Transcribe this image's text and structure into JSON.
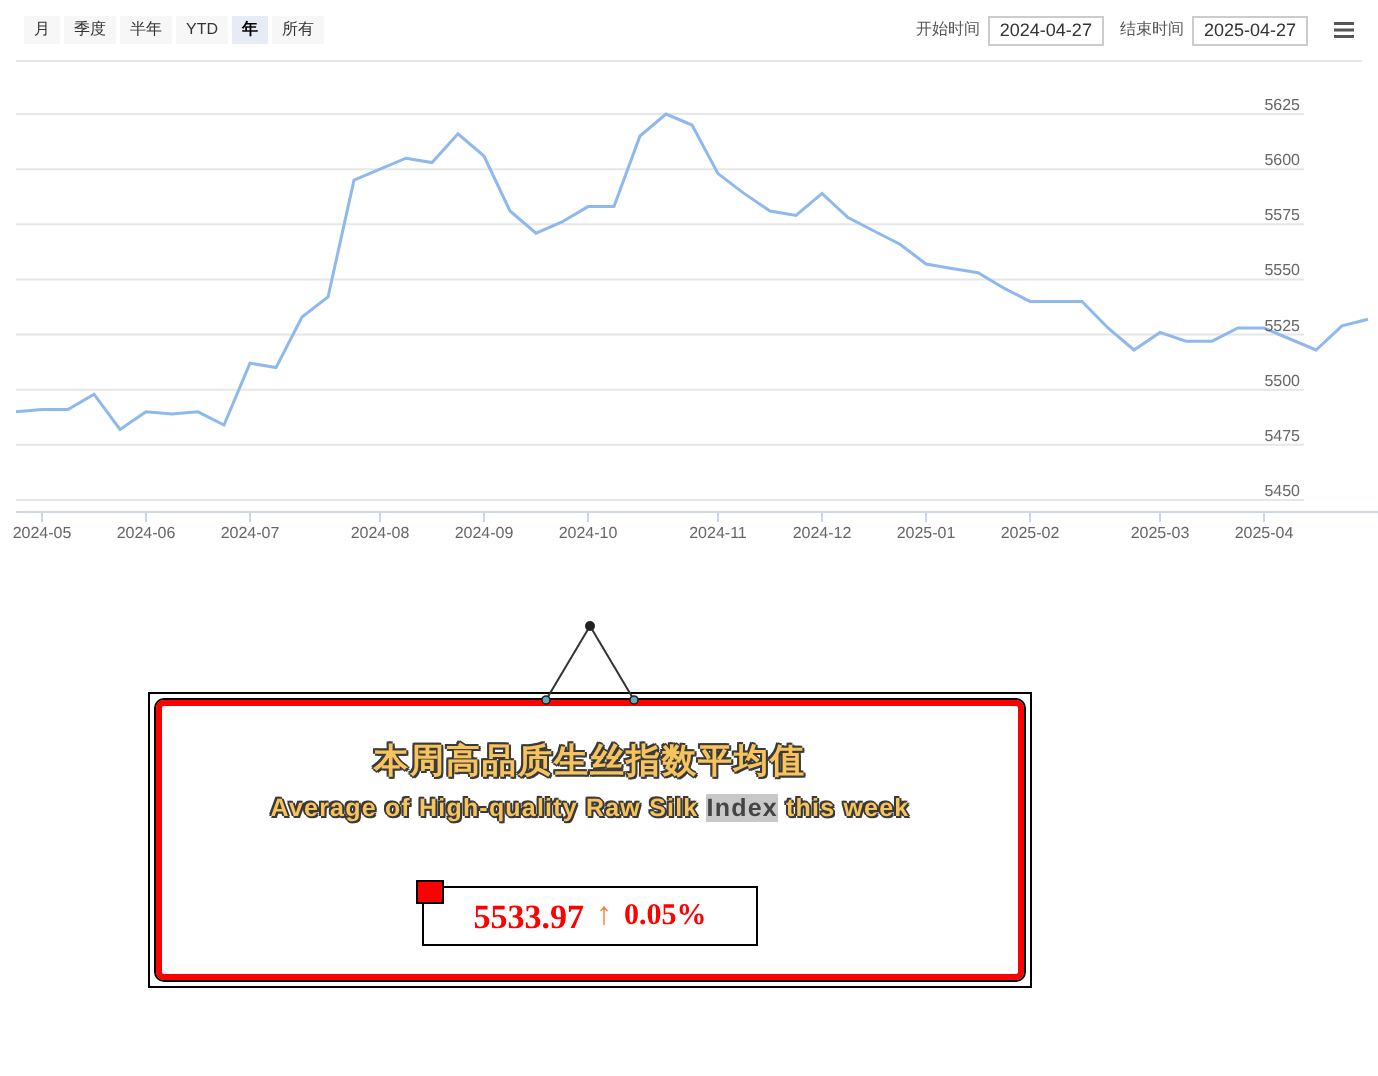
{
  "range_buttons": [
    {
      "label": "月",
      "selected": false
    },
    {
      "label": "季度",
      "selected": false
    },
    {
      "label": "半年",
      "selected": false
    },
    {
      "label": "YTD",
      "selected": false
    },
    {
      "label": "年",
      "selected": true
    },
    {
      "label": "所有",
      "selected": false
    }
  ],
  "start_date": {
    "label": "开始时间",
    "value": "2024-04-27"
  },
  "end_date": {
    "label": "结束时间",
    "value": "2025-04-27"
  },
  "chart": {
    "chart_data": {
      "type": "line",
      "categories": [
        null,
        "2024-05",
        null,
        null,
        null,
        "2024-06",
        null,
        null,
        null,
        "2024-07",
        null,
        null,
        null,
        null,
        "2024-08",
        null,
        null,
        null,
        "2024-09",
        null,
        null,
        null,
        "2024-10",
        null,
        null,
        null,
        null,
        "2024-11",
        null,
        null,
        null,
        "2024-12",
        null,
        null,
        null,
        "2025-01",
        null,
        null,
        null,
        "2025-02",
        null,
        null,
        null,
        null,
        "2025-03",
        null,
        null,
        null,
        "2025-04",
        null,
        null,
        null,
        null
      ],
      "series": [
        {
          "color": "#8fb8ec",
          "values": [
            5490,
            5491,
            5491,
            5498,
            5482,
            5490,
            5489,
            5490,
            5484,
            5512,
            5510,
            5533,
            5542,
            5595,
            5600,
            5605,
            5603,
            5616,
            5606,
            5581,
            5571,
            5576,
            5583,
            5583,
            5615,
            5625,
            5620,
            5598,
            5589,
            5581,
            5579,
            5589,
            5578,
            5572,
            5566,
            5557,
            5555,
            5553,
            5546,
            5540,
            5540,
            5540,
            5528,
            5518,
            5526,
            5522,
            5522,
            5528,
            5528,
            5523,
            5518,
            5529,
            5532
          ]
        }
      ],
      "ylim": [
        5450,
        5625
      ],
      "grid": true,
      "yticks": [
        {
          "value": 5450,
          "label": "5450"
        },
        {
          "value": 5475,
          "label": "5475"
        },
        {
          "value": 5500,
          "label": "5500"
        },
        {
          "value": 5525,
          "label": "5525"
        },
        {
          "value": 5550,
          "label": "5550"
        },
        {
          "value": 5575,
          "label": "5575"
        },
        {
          "value": 5600,
          "label": "5600"
        },
        {
          "value": 5625,
          "label": "5625"
        }
      ]
    }
  },
  "card": {
    "title": "本周高品质生丝指数平均值",
    "subtitle_parts": [
      {
        "text": "Average of High-quality Raw Silk ",
        "highlighted": false
      },
      {
        "text": "Index",
        "highlighted": true
      },
      {
        "text": " this week",
        "highlighted": false
      }
    ],
    "value": "5533.97",
    "arrow": "↑",
    "change": "0.05%"
  }
}
